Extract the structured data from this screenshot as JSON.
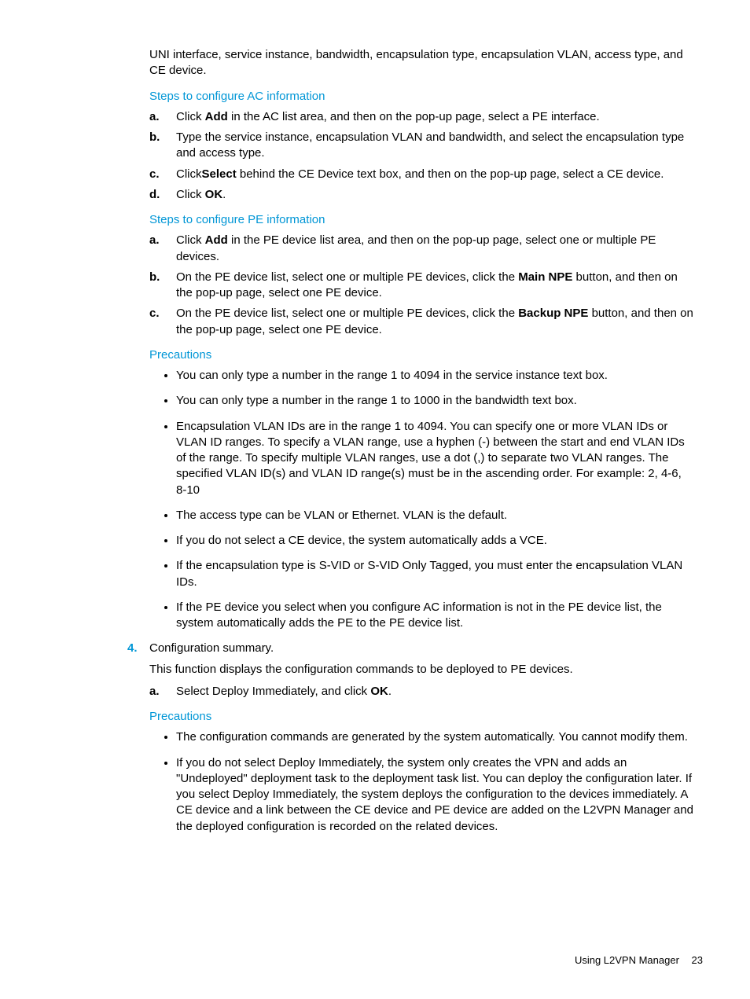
{
  "intro": "UNI interface, service instance, bandwidth, encapsulation type, encapsulation VLAN, access type, and CE device.",
  "sec_ac": {
    "heading": "Steps to configure AC information",
    "items": [
      {
        "m": "a.",
        "pre": "Click ",
        "b": "Add",
        "post": " in the AC list area, and then on the pop-up page, select a PE interface."
      },
      {
        "m": "b.",
        "pre": "Type the service instance, encapsulation VLAN and bandwidth, and select the encapsulation type and access type.",
        "b": "",
        "post": ""
      },
      {
        "m": "c.",
        "pre": "Click",
        "b": "Select",
        "post": " behind the CE Device text box, and then on the pop-up page, select a CE device."
      },
      {
        "m": "d.",
        "pre": "Click ",
        "b": "OK",
        "post": "."
      }
    ]
  },
  "sec_pe": {
    "heading": "Steps to configure PE information",
    "items": [
      {
        "m": "a.",
        "pre": "Click ",
        "b": "Add",
        "post": " in the PE device list area, and then on the pop-up page, select one or multiple PE devices."
      },
      {
        "m": "b.",
        "pre": "On the PE device list, select one or multiple PE devices, click the ",
        "b": "Main NPE",
        "post": " button, and then on the pop-up page, select one PE device."
      },
      {
        "m": "c.",
        "pre": "On the PE device list, select one or multiple PE devices, click the ",
        "b": "Backup NPE",
        "post": " button, and then on the pop-up page, select one PE device."
      }
    ]
  },
  "precautions1": {
    "heading": "Precautions",
    "items": [
      "You can only type a number in the range 1 to 4094 in the service instance text box.",
      "You can only type a number in the range 1 to 1000 in the bandwidth text box.",
      "Encapsulation VLAN IDs are in the range 1 to 4094. You can specify one or more VLAN IDs or VLAN ID ranges. To specify a VLAN range, use a hyphen (-) between the start and end VLAN IDs of the range. To specify multiple VLAN ranges, use a dot (,) to separate two VLAN ranges. The specified VLAN ID(s) and VLAN ID range(s) must be in the ascending order. For example: 2, 4-6, 8-10",
      "The access type can be VLAN or Ethernet. VLAN is the default.",
      "If you do not select a CE device, the system automatically adds a VCE.",
      "If the encapsulation type is S-VID or S-VID Only Tagged, you must enter the encapsulation VLAN IDs.",
      "If the PE device you select when you configure AC information is not in the PE device list, the system automatically adds the PE to the PE device list."
    ]
  },
  "step4": {
    "num": "4.",
    "title": "Configuration summary.",
    "desc": "This function displays the configuration commands to be deployed to PE devices.",
    "sub": {
      "m": "a.",
      "pre": "Select Deploy Immediately, and click ",
      "b": "OK",
      "post": "."
    }
  },
  "precautions2": {
    "heading": "Precautions",
    "items": [
      "The configuration commands are generated by the system automatically. You cannot modify them.",
      "If you do not select Deploy Immediately, the system only creates the VPN and adds an \"Undeployed\" deployment task to the deployment task list. You can deploy the configuration later. If you select Deploy Immediately, the system deploys the configuration to the devices immediately. A CE device and a link between the CE device and PE device are added on the L2VPN Manager and the deployed configuration is recorded on the related devices."
    ]
  },
  "footer": {
    "text": "Using L2VPN Manager",
    "page": "23"
  }
}
